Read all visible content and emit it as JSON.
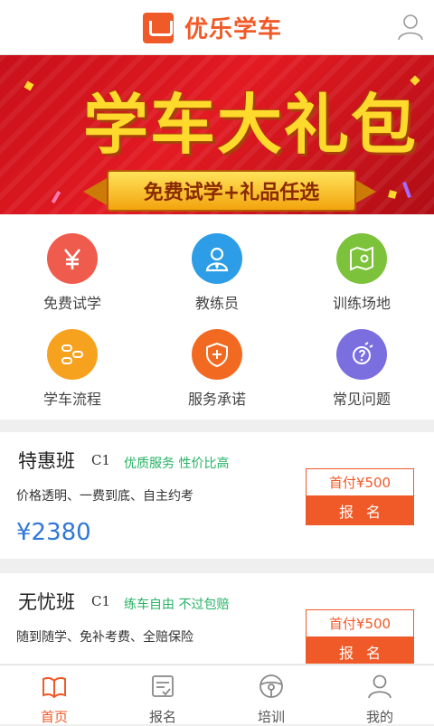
{
  "header": {
    "app_name": "优乐学车"
  },
  "banner": {
    "title": "学车大礼包",
    "subtitle": "免费试学+礼品任选"
  },
  "grid": [
    {
      "label": "免费试学",
      "icon": "yen-icon",
      "color": "#ef5b4c"
    },
    {
      "label": "教练员",
      "icon": "coach-icon",
      "color": "#2c9de6"
    },
    {
      "label": "训练场地",
      "icon": "map-icon",
      "color": "#7cc23a"
    },
    {
      "label": "学车流程",
      "icon": "flow-icon",
      "color": "#f7a21f"
    },
    {
      "label": "服务承诺",
      "icon": "shield-icon",
      "color": "#f26a21"
    },
    {
      "label": "常见问题",
      "icon": "question-icon",
      "color": "#7b6fe0"
    }
  ],
  "courses": [
    {
      "name": "特惠班",
      "level": "C1",
      "tags": "优质服务  性价比高",
      "desc": "价格透明、一费到底、自主约考",
      "price": "¥2380",
      "down_payment": "首付¥500",
      "signup": "报名"
    },
    {
      "name": "无忧班",
      "level": "C1",
      "tags": "练车自由  不过包赔",
      "desc": "随到随学、免补考费、全赔保险",
      "down_payment": "首付¥500",
      "signup": "报名"
    }
  ],
  "tabs": [
    {
      "label": "首页",
      "active": true
    },
    {
      "label": "报名",
      "active": false
    },
    {
      "label": "培训",
      "active": false
    },
    {
      "label": "我的",
      "active": false
    }
  ],
  "colors": {
    "brand": "#f05a28",
    "tag_green": "#25b363",
    "price_blue": "#2f77d6"
  }
}
